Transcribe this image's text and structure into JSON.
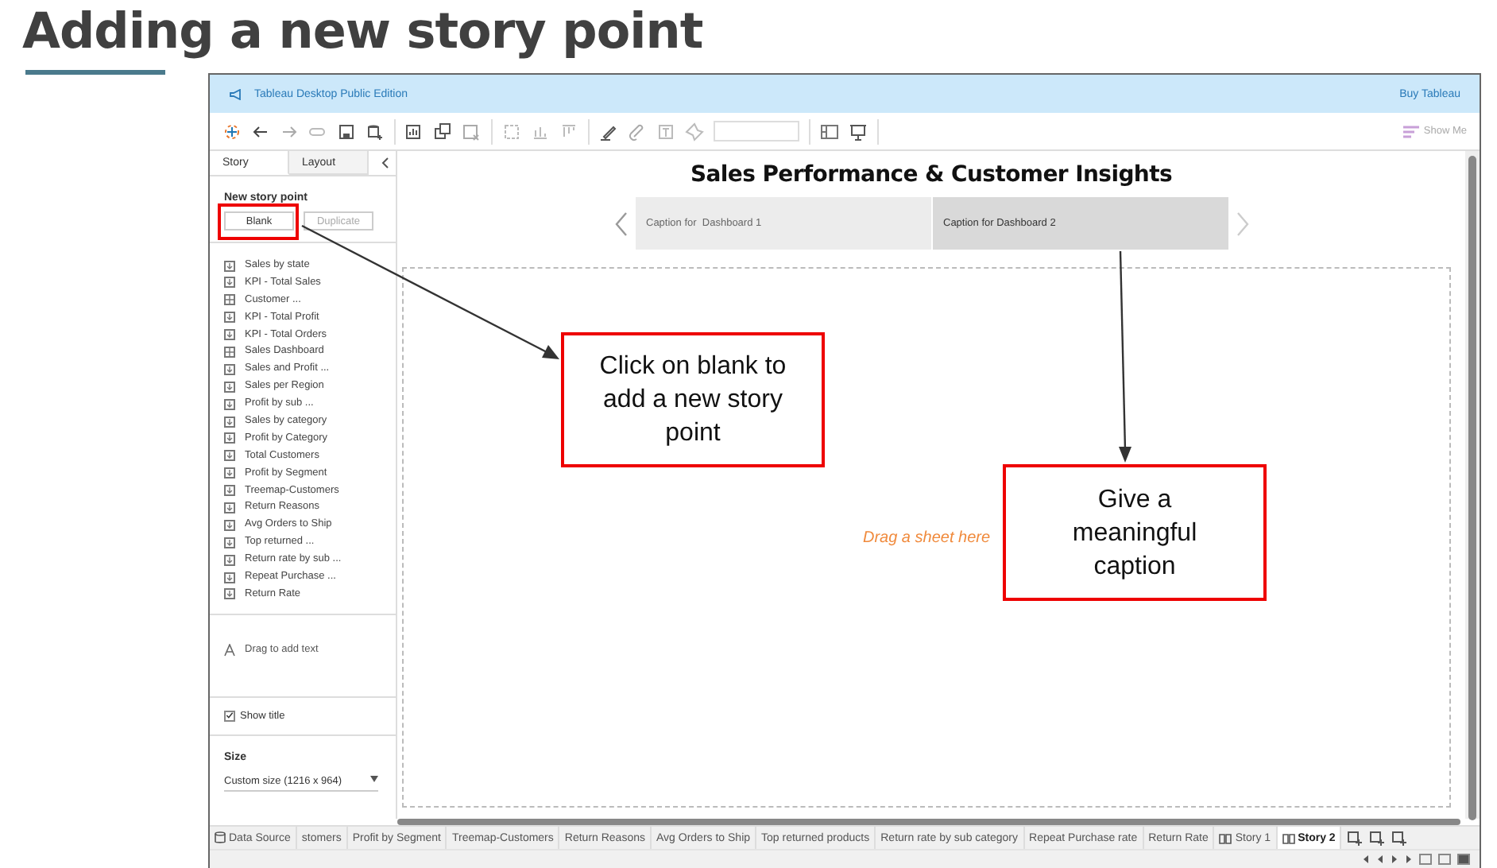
{
  "slide": {
    "title": "Adding a new story point"
  },
  "app": {
    "edition": "Tableau Desktop Public Edition",
    "buy_link": "Buy Tableau",
    "show_me": "Show Me"
  },
  "sidebar": {
    "tabs": [
      {
        "label": "Story",
        "selected": true
      },
      {
        "label": "Layout",
        "selected": false
      }
    ],
    "new_story_point": "New story point",
    "buttons": [
      {
        "label": "Blank",
        "disabled": false
      },
      {
        "label": "Duplicate",
        "disabled": true
      }
    ],
    "sheets": [
      {
        "label": "Sales by state",
        "kind": "sheet"
      },
      {
        "label": "KPI - Total Sales",
        "kind": "sheet"
      },
      {
        "label": "Customer ...",
        "kind": "dashboard"
      },
      {
        "label": "KPI - Total Profit",
        "kind": "sheet"
      },
      {
        "label": "KPI - Total Orders",
        "kind": "sheet"
      },
      {
        "label": "Sales Dashboard",
        "kind": "dashboard"
      },
      {
        "label": "Sales and Profit ...",
        "kind": "sheet"
      },
      {
        "label": "Sales per Region",
        "kind": "sheet"
      },
      {
        "label": "Profit by sub ...",
        "kind": "sheet"
      },
      {
        "label": "Sales by category",
        "kind": "sheet"
      },
      {
        "label": "Profit by Category",
        "kind": "sheet"
      },
      {
        "label": "Total Customers",
        "kind": "sheet"
      },
      {
        "label": "Profit by Segment",
        "kind": "sheet"
      },
      {
        "label": "Treemap-Customers",
        "kind": "sheet"
      },
      {
        "label": "Return Reasons",
        "kind": "sheet"
      },
      {
        "label": "Avg Orders to Ship",
        "kind": "sheet"
      },
      {
        "label": "Top returned ...",
        "kind": "sheet"
      },
      {
        "label": "Return rate by sub ...",
        "kind": "sheet"
      },
      {
        "label": "Repeat Purchase ...",
        "kind": "sheet"
      },
      {
        "label": "Return Rate",
        "kind": "sheet"
      }
    ],
    "drag_text": "Drag to add text",
    "show_title": {
      "label": "Show title",
      "checked": true
    },
    "size": {
      "heading": "Size",
      "value": "Custom size (1216 x 964)"
    }
  },
  "story": {
    "title": "Sales Performance & Customer Insights",
    "captions": [
      {
        "label": "Caption for  Dashboard 1",
        "selected": false
      },
      {
        "label": "Caption for Dashboard 2",
        "selected": true
      }
    ],
    "drop_hint": "Drag a sheet here"
  },
  "sheet_tabs": [
    {
      "label": "Data Source",
      "kind": "datasource",
      "selected": false
    },
    {
      "label": "stomers",
      "kind": "sheet",
      "selected": false
    },
    {
      "label": "Profit by Segment",
      "kind": "sheet",
      "selected": false
    },
    {
      "label": "Treemap-Customers",
      "kind": "sheet",
      "selected": false
    },
    {
      "label": "Return Reasons",
      "kind": "sheet",
      "selected": false
    },
    {
      "label": "Avg Orders to Ship",
      "kind": "sheet",
      "selected": false
    },
    {
      "label": "Top returned products",
      "kind": "sheet",
      "selected": false
    },
    {
      "label": "Return rate by sub category",
      "kind": "sheet",
      "selected": false
    },
    {
      "label": "Repeat Purchase rate",
      "kind": "sheet",
      "selected": false
    },
    {
      "label": "Return Rate",
      "kind": "sheet",
      "selected": false
    },
    {
      "label": "Story 1",
      "kind": "story",
      "selected": false
    },
    {
      "label": "Story 2",
      "kind": "story",
      "selected": true
    }
  ],
  "callouts": [
    {
      "text": "Click on blank to add a new story point"
    },
    {
      "text": "Give a meaningful caption"
    }
  ]
}
